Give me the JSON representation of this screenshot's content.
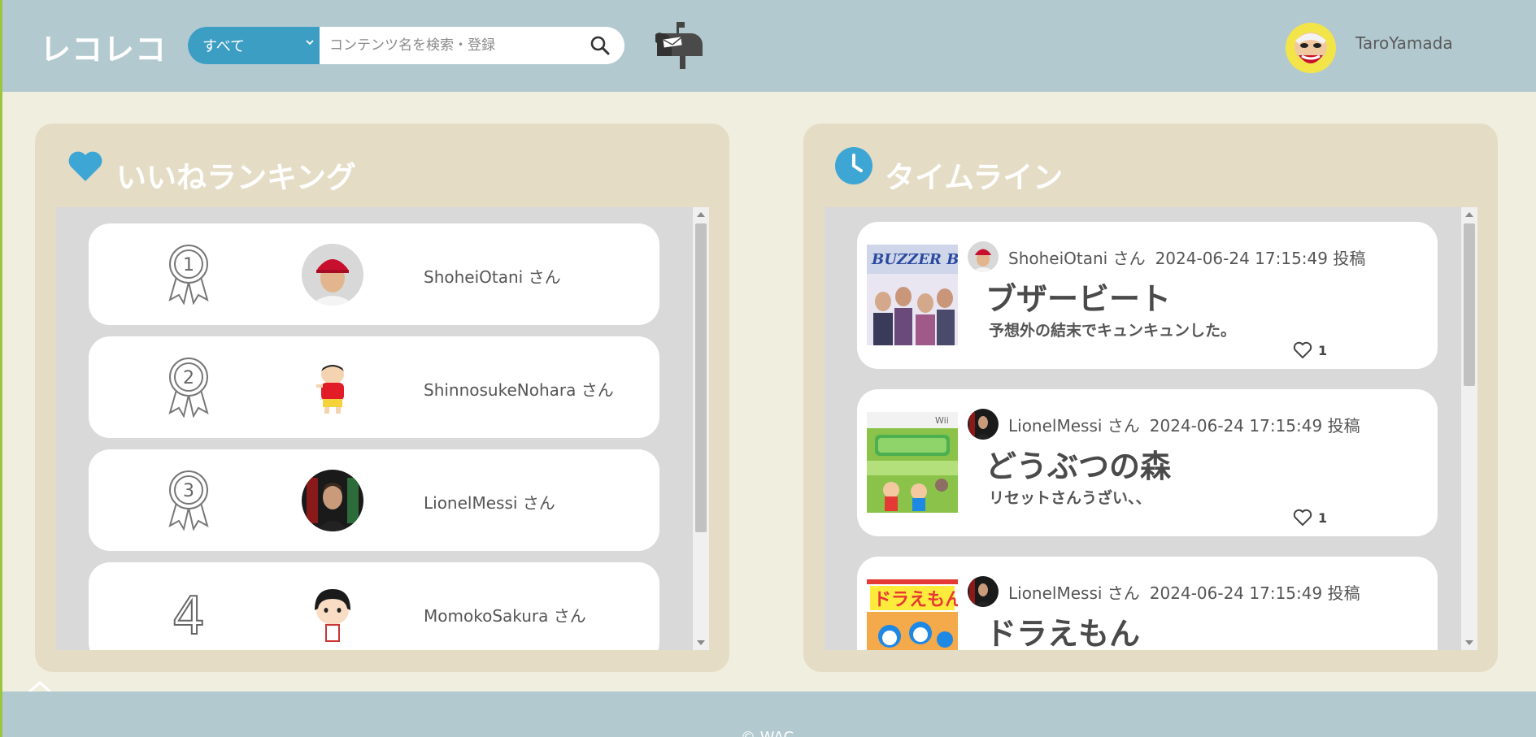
{
  "header": {
    "logo": "レコレコ",
    "search": {
      "category_selected": "すべて",
      "placeholder": "コンテンツ名を検索・登録"
    },
    "user": {
      "name": "TaroYamada"
    }
  },
  "ranking": {
    "title": "いいねランキング",
    "items": [
      {
        "rank": "1",
        "name": "ShoheiOtani さん"
      },
      {
        "rank": "2",
        "name": "ShinnosukeNohara さん"
      },
      {
        "rank": "3",
        "name": "LionelMessi さん"
      },
      {
        "rank": "4",
        "name": "MomokoSakura さん"
      }
    ]
  },
  "timeline": {
    "title": "タイムライン",
    "posts": [
      {
        "user": "ShoheiOtani さん",
        "date": "2024-06-24 17:15:49 投稿",
        "title": "ブザービート",
        "body": "予想外の結末でキュンキュンした。",
        "likes": "1"
      },
      {
        "user": "LionelMessi さん",
        "date": "2024-06-24 17:15:49 投稿",
        "title": "どうぶつの森",
        "body": "リセットさんうざい、、",
        "likes": "1"
      },
      {
        "user": "LionelMessi さん",
        "date": "2024-06-24 17:15:49 投稿",
        "title": "ドラえもん",
        "body": "",
        "likes": ""
      }
    ]
  },
  "footer": {
    "copyright": "© WAC"
  },
  "colors": {
    "header_bg": "#b3c9d0",
    "page_bg": "#f0efdf",
    "panel_bg": "#e4dcc4",
    "accent_blue": "#3d9ec4"
  },
  "icons": {
    "search": "search-icon",
    "mailbox": "mailbox-icon",
    "heart": "heart-icon",
    "clock": "clock-icon",
    "medal": "medal-icon",
    "like": "heart-outline-icon",
    "back_to_top": "chevron-up-icon"
  }
}
